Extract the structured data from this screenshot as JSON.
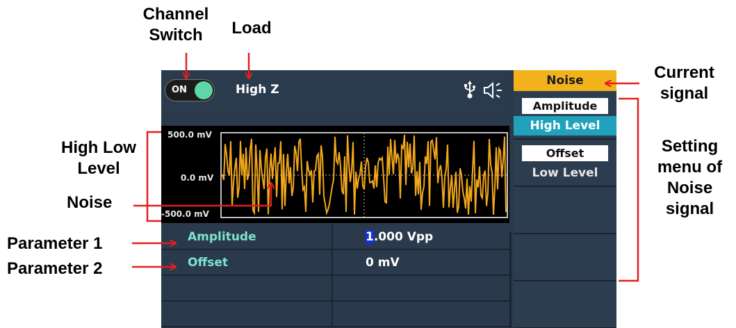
{
  "annotations": {
    "channel_switch": "Channel\nSwitch",
    "load": "Load",
    "current_signal": "Current\nsignal",
    "high_low_level": "High Low\nLevel",
    "noise": "Noise",
    "setting_menu": "Setting\nmenu of\nNoise\nsignal",
    "parameter_1": "Parameter 1",
    "parameter_2": "Parameter 2"
  },
  "status_bar": {
    "channel_state": "ON",
    "load": "High Z",
    "icons": [
      "usb-icon",
      "speaker-icon"
    ]
  },
  "waveform": {
    "type": "noise",
    "y_top_label": "500.0 mV",
    "y_mid_label": "0.0 mV",
    "y_bottom_label": "-500.0 mV",
    "color": "#f3a81c"
  },
  "parameters": [
    {
      "name": "Amplitude",
      "value_cursor": "1",
      "value_rest": ".000 Vpp"
    },
    {
      "name": "Offset",
      "value_cursor": "",
      "value_rest": "0 mV"
    },
    {
      "name": "",
      "value_cursor": "",
      "value_rest": ""
    },
    {
      "name": "",
      "value_cursor": "",
      "value_rest": ""
    }
  ],
  "menu": {
    "title": "Noise",
    "buttons": [
      {
        "top": "Amplitude",
        "bottom": "High Level",
        "selected": true
      },
      {
        "top": "Offset",
        "bottom": "Low Level",
        "selected": false
      },
      {
        "top": "",
        "bottom": "",
        "selected": false
      },
      {
        "top": "",
        "bottom": "",
        "selected": false
      },
      {
        "top": "",
        "bottom": "",
        "selected": false
      }
    ]
  },
  "colors": {
    "arrow": "#e41e1e",
    "menu_title_bg": "#f2b21c",
    "menu_selected_bg": "#20a2bc",
    "param_name": "#7fe3d0",
    "toggle_on": "#5fd6a9"
  }
}
